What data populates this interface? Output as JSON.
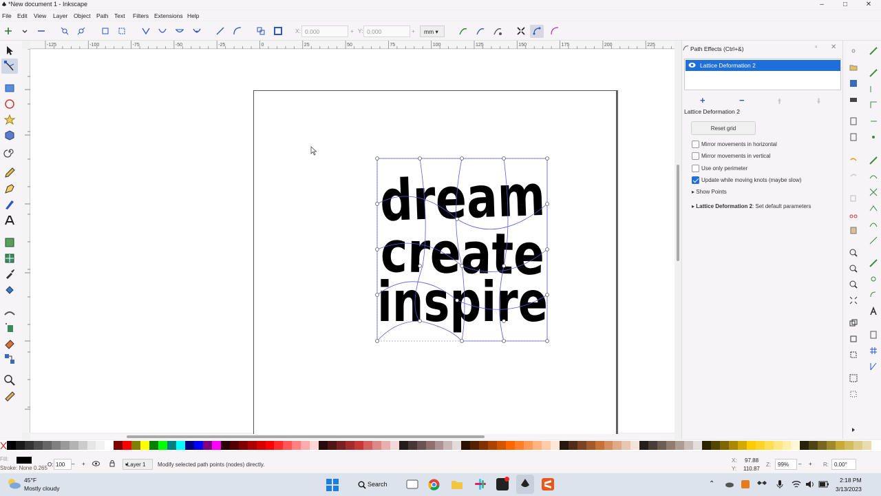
{
  "window": {
    "title": "*New document 1 - Inkscape"
  },
  "menu": [
    "File",
    "Edit",
    "View",
    "Layer",
    "Object",
    "Path",
    "Text",
    "Filters",
    "Extensions",
    "Help"
  ],
  "toolbar": {
    "x_label": "X:",
    "x_value": "0.000",
    "y_label": "Y:",
    "y_value": "0.000",
    "unit": "mm"
  },
  "ruler": {
    "h_ticks": [
      "-125",
      "-100",
      "-75",
      "-50",
      "-25",
      "0",
      "25",
      "50",
      "75",
      "100",
      "125",
      "150",
      "175",
      "200",
      "225"
    ]
  },
  "canvas": {
    "lines": [
      "dream",
      "create",
      "inspire"
    ]
  },
  "panel": {
    "title": "Path Effects (Ctrl+&)",
    "effects": [
      "Lattice Deformation 2"
    ],
    "add_label": "+",
    "remove_label": "−",
    "effect_name": "Lattice Deformation 2",
    "reset_label": "Reset grid",
    "options": [
      {
        "label": "Mirror movements in horizontal",
        "checked": false
      },
      {
        "label": "Mirror movements in vertical",
        "checked": false
      },
      {
        "label": "Use only perimeter",
        "checked": false
      },
      {
        "label": "Update while moving knots (maybe slow)",
        "checked": true
      }
    ],
    "show_points": "Show Points",
    "defaults_bold": "Lattice Deformation 2",
    "defaults_rest": ": Set default parameters"
  },
  "status": {
    "fill_label": "Fill:",
    "stroke_text": "Stroke: None 0.265",
    "opacity_label": "O:",
    "opacity_value": "100",
    "layer": "•Layer 1",
    "message": "Modify selected path points (nodes) directly.",
    "x_label": "X:",
    "x_value": "97.88",
    "y_label": "Y:",
    "y_value": "110.87",
    "zoom_label": "Z:",
    "zoom_value": "99%",
    "rotate_label": "R:",
    "rotate_value": "0.00°"
  },
  "taskbar": {
    "temp": "45°F",
    "weather": "Mostly cloudy",
    "search": "Search",
    "time": "2:18 PM",
    "date": "3/13/2023"
  },
  "colors": {
    "selection": "#1e6fd9",
    "lattice": "#5a5ae0",
    "palette": [
      "#000000",
      "#1a1a1a",
      "#333333",
      "#4d4d4d",
      "#666666",
      "#808080",
      "#999999",
      "#b3b3b3",
      "#cccccc",
      "#e6e6e6",
      "#f2f2f2",
      "#ffffff",
      "#800000",
      "#ff0000",
      "#808000",
      "#ffff00",
      "#008000",
      "#00ff00",
      "#008080",
      "#00ffff",
      "#000080",
      "#0000ff",
      "#800080",
      "#ff00ff",
      "#2b0000",
      "#550000",
      "#800000",
      "#aa0000",
      "#d40000",
      "#ff0000",
      "#ff2a2a",
      "#ff5555",
      "#ff8080",
      "#ffaaaa",
      "#ffd5d5",
      "#280b0b",
      "#501616",
      "#782121",
      "#a02c2c",
      "#c83737",
      "#d35f5f",
      "#de8787",
      "#e9afaf",
      "#f4d7d7",
      "#241c1c",
      "#483737",
      "#6c5353",
      "#916f6f",
      "#ac9393",
      "#c8b7b7",
      "#e3dbdb",
      "#2b1100",
      "#552200",
      "#803300",
      "#aa4400",
      "#d45500",
      "#ff6600",
      "#ff7f2a",
      "#ff9955",
      "#ffb380",
      "#ffccaa",
      "#ffe6d5",
      "#28170b",
      "#502d16",
      "#784421",
      "#a05a2c",
      "#c87137",
      "#d38d5f",
      "#deaa87",
      "#e9c6af",
      "#f4e3d7",
      "#241f1c",
      "#483e37",
      "#6c5d53",
      "#917c6f",
      "#ac9d93",
      "#c8beb7",
      "#e3dedb",
      "#2b2200",
      "#554400",
      "#806600",
      "#aa8800",
      "#d4aa00",
      "#ffcc00",
      "#ffd42a",
      "#ffdd55",
      "#ffe680",
      "#ffeeaa",
      "#fff6d5",
      "#28220b",
      "#504416",
      "#786721",
      "#a0892c",
      "#c8ab37",
      "#d3bc5f",
      "#decd87",
      "#e9ddaf"
    ]
  }
}
